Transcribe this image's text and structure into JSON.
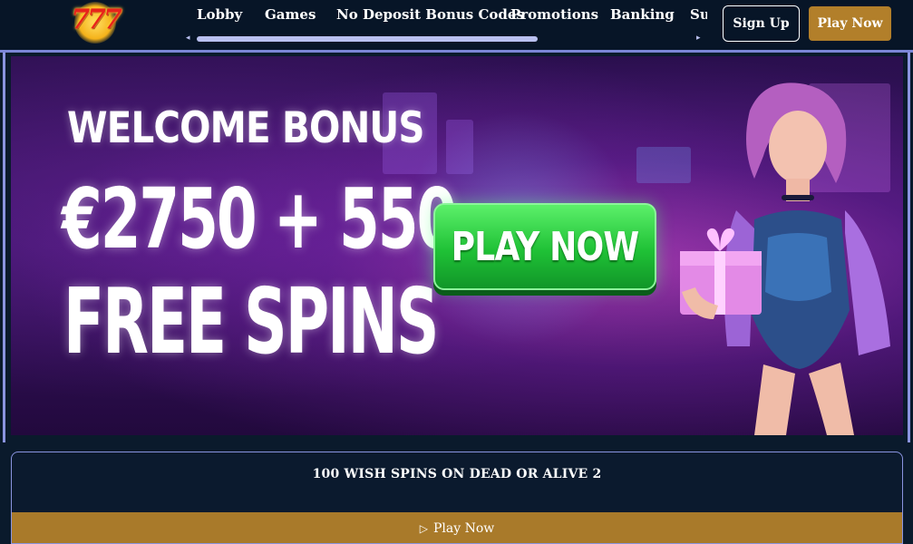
{
  "header": {
    "logo_text": "777",
    "nav": [
      "Lobby",
      "Games",
      "No Deposit Bonus Codes",
      "Promotions",
      "Banking",
      "Su"
    ],
    "signup_label": "Sign Up",
    "play_label": "Play Now"
  },
  "hero": {
    "title": "WELCOME BONUS",
    "amount": "€2750 + 550",
    "spins": "FREE SPINS",
    "cta": "PLAY NOW"
  },
  "promo": {
    "title": "100 WISH SPINS ON DEAD OR ALIVE 2",
    "button_label": "Play Now"
  },
  "colors": {
    "header_bg": "#071527",
    "accent_gold": "#b27f2a",
    "border_lavender": "#8a94e0",
    "cta_green": "#1fc136"
  },
  "icons": [
    "logo-777-icon",
    "scroll-left-icon",
    "scroll-right-icon",
    "play-triangle-icon"
  ]
}
